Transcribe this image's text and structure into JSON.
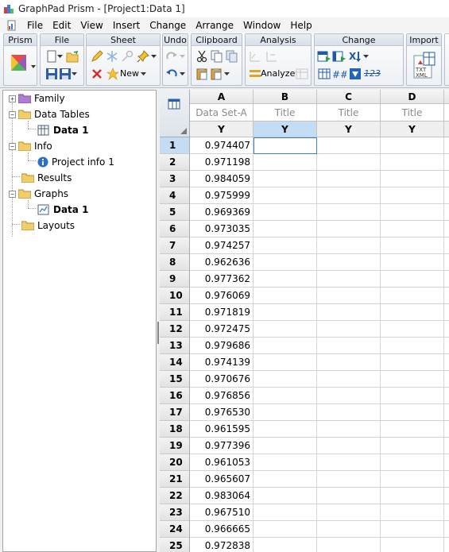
{
  "window": {
    "title": "GraphPad Prism - [Project1:Data 1]"
  },
  "menu": {
    "items": [
      "File",
      "Edit",
      "View",
      "Insert",
      "Change",
      "Arrange",
      "Window",
      "Help"
    ]
  },
  "toolbar": {
    "groups": [
      {
        "label": "Prism"
      },
      {
        "label": "File"
      },
      {
        "label": "Sheet"
      },
      {
        "label": "Undo"
      },
      {
        "label": "Clipboard"
      },
      {
        "label": "Analysis"
      },
      {
        "label": "Change"
      },
      {
        "label": "Import"
      }
    ],
    "sheet_new_label": "New",
    "analyze_label": "Analyze",
    "change_123_label": "123"
  },
  "navigator": {
    "items": [
      {
        "label": "Family",
        "icon": "purple-folder-icon"
      },
      {
        "label": "Data Tables",
        "icon": "folder-icon"
      },
      {
        "label": "Data 1",
        "icon": "data-table-icon"
      },
      {
        "label": "Info",
        "icon": "folder-icon"
      },
      {
        "label": "Project info 1",
        "icon": "info-icon"
      },
      {
        "label": "Results",
        "icon": "folder-icon"
      },
      {
        "label": "Graphs",
        "icon": "folder-icon"
      },
      {
        "label": "Data 1",
        "icon": "graph-icon"
      },
      {
        "label": "Layouts",
        "icon": "folder-icon"
      }
    ]
  },
  "sheet": {
    "columns": [
      {
        "letter": "A",
        "title": "Data Set-A",
        "y": "Y"
      },
      {
        "letter": "B",
        "title": "Title",
        "y": "Y"
      },
      {
        "letter": "C",
        "title": "Title",
        "y": "Y"
      },
      {
        "letter": "D",
        "title": "Title",
        "y": "Y"
      }
    ],
    "rows": [
      {
        "n": "1",
        "a": "0.974407"
      },
      {
        "n": "2",
        "a": "0.971198"
      },
      {
        "n": "3",
        "a": "0.984059"
      },
      {
        "n": "4",
        "a": "0.975999"
      },
      {
        "n": "5",
        "a": "0.969369"
      },
      {
        "n": "6",
        "a": "0.973035"
      },
      {
        "n": "7",
        "a": "0.974257"
      },
      {
        "n": "8",
        "a": "0.962636"
      },
      {
        "n": "9",
        "a": "0.977362"
      },
      {
        "n": "10",
        "a": "0.976069"
      },
      {
        "n": "11",
        "a": "0.971819"
      },
      {
        "n": "12",
        "a": "0.972475"
      },
      {
        "n": "13",
        "a": "0.979686"
      },
      {
        "n": "14",
        "a": "0.974139"
      },
      {
        "n": "15",
        "a": "0.970676"
      },
      {
        "n": "16",
        "a": "0.976856"
      },
      {
        "n": "17",
        "a": "0.976530"
      },
      {
        "n": "18",
        "a": "0.961595"
      },
      {
        "n": "19",
        "a": "0.977396"
      },
      {
        "n": "20",
        "a": "0.961053"
      },
      {
        "n": "21",
        "a": "0.965607"
      },
      {
        "n": "22",
        "a": "0.983064"
      },
      {
        "n": "23",
        "a": "0.967510"
      },
      {
        "n": "24",
        "a": "0.966665"
      },
      {
        "n": "25",
        "a": "0.972838"
      }
    ]
  }
}
